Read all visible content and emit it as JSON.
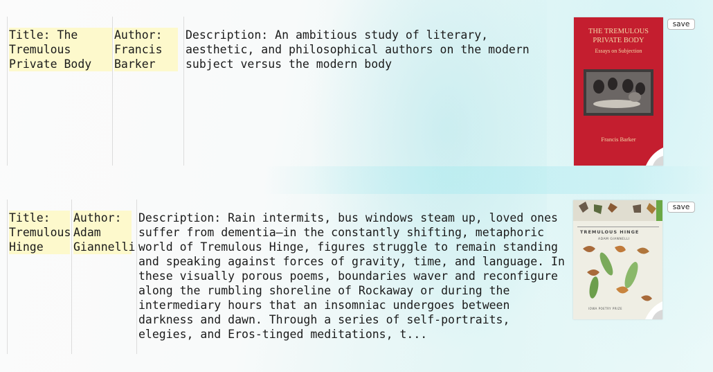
{
  "results": [
    {
      "title": "Title: The Tremulous Private Body",
      "author": "Author: Francis Barker",
      "description": "Description: An ambitious study of literary, aesthetic, and philosophical authors on the modern subject versus the modern body",
      "cover": {
        "title": "THE TREMULOUS PRIVATE BODY",
        "subtitle": "Essays on Subjection",
        "author": "Francis Barker",
        "colors": {
          "background": "#c41e2f",
          "text": "#f3d9a8"
        }
      },
      "save_label": "save"
    },
    {
      "title": "Title: Tremulous Hinge",
      "author": "Author: Adam Giannelli",
      "description": "Description: Rain intermits, bus windows steam up, loved ones suffer from dementia—in the constantly shifting, metaphoric world of Tremulous Hinge, figures struggle to remain standing and speaking against forces of gravity, time, and language. In these visually porous poems, boundaries waver and reconfigure along the rumbling shoreline of Rockaway or during the intermediary hours that an insomniac undergoes between darkness and dawn. Through a series of self-portraits, elegies, and Eros-tinged meditations, t...",
      "cover": {
        "title": "TREMULOUS HINGE",
        "author": "ADAM GIANNELLI",
        "publisher": "IOWA POETRY PRIZE",
        "colors": {
          "background": "#efeee4",
          "text": "#444444"
        }
      },
      "save_label": "save"
    }
  ]
}
